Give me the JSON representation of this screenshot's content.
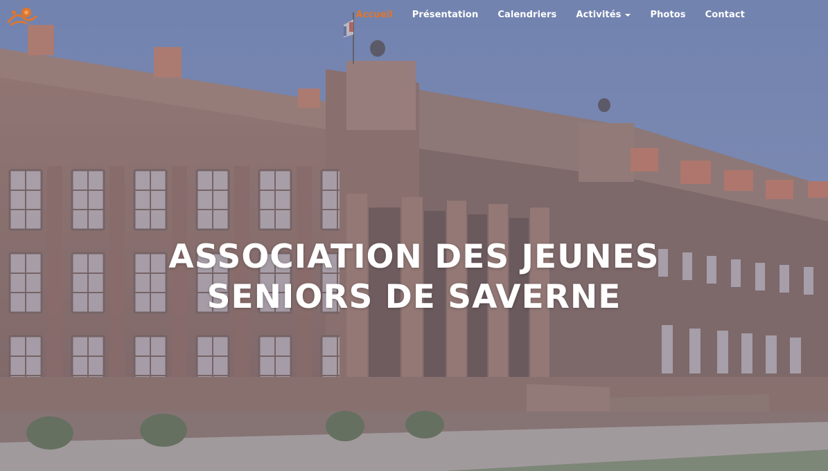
{
  "nav": {
    "items": [
      {
        "label": "Accueil",
        "active": true
      },
      {
        "label": "Présentation",
        "active": false
      },
      {
        "label": "Calendriers",
        "active": false
      },
      {
        "label": "Activités",
        "active": false,
        "dropdown": true
      },
      {
        "label": "Photos",
        "active": false
      },
      {
        "label": "Contact",
        "active": false
      }
    ]
  },
  "hero": {
    "title_line1": "ASSOCIATION DES JEUNES",
    "title_line2": "SENIORS DE SAVERNE"
  },
  "colors": {
    "accent": "#e0762b",
    "sky": "#6f88ba",
    "stone": "#8f6a5e",
    "overlay": "#7f7c93"
  },
  "icons": [
    "association-logo-icon",
    "caret-down-icon"
  ]
}
